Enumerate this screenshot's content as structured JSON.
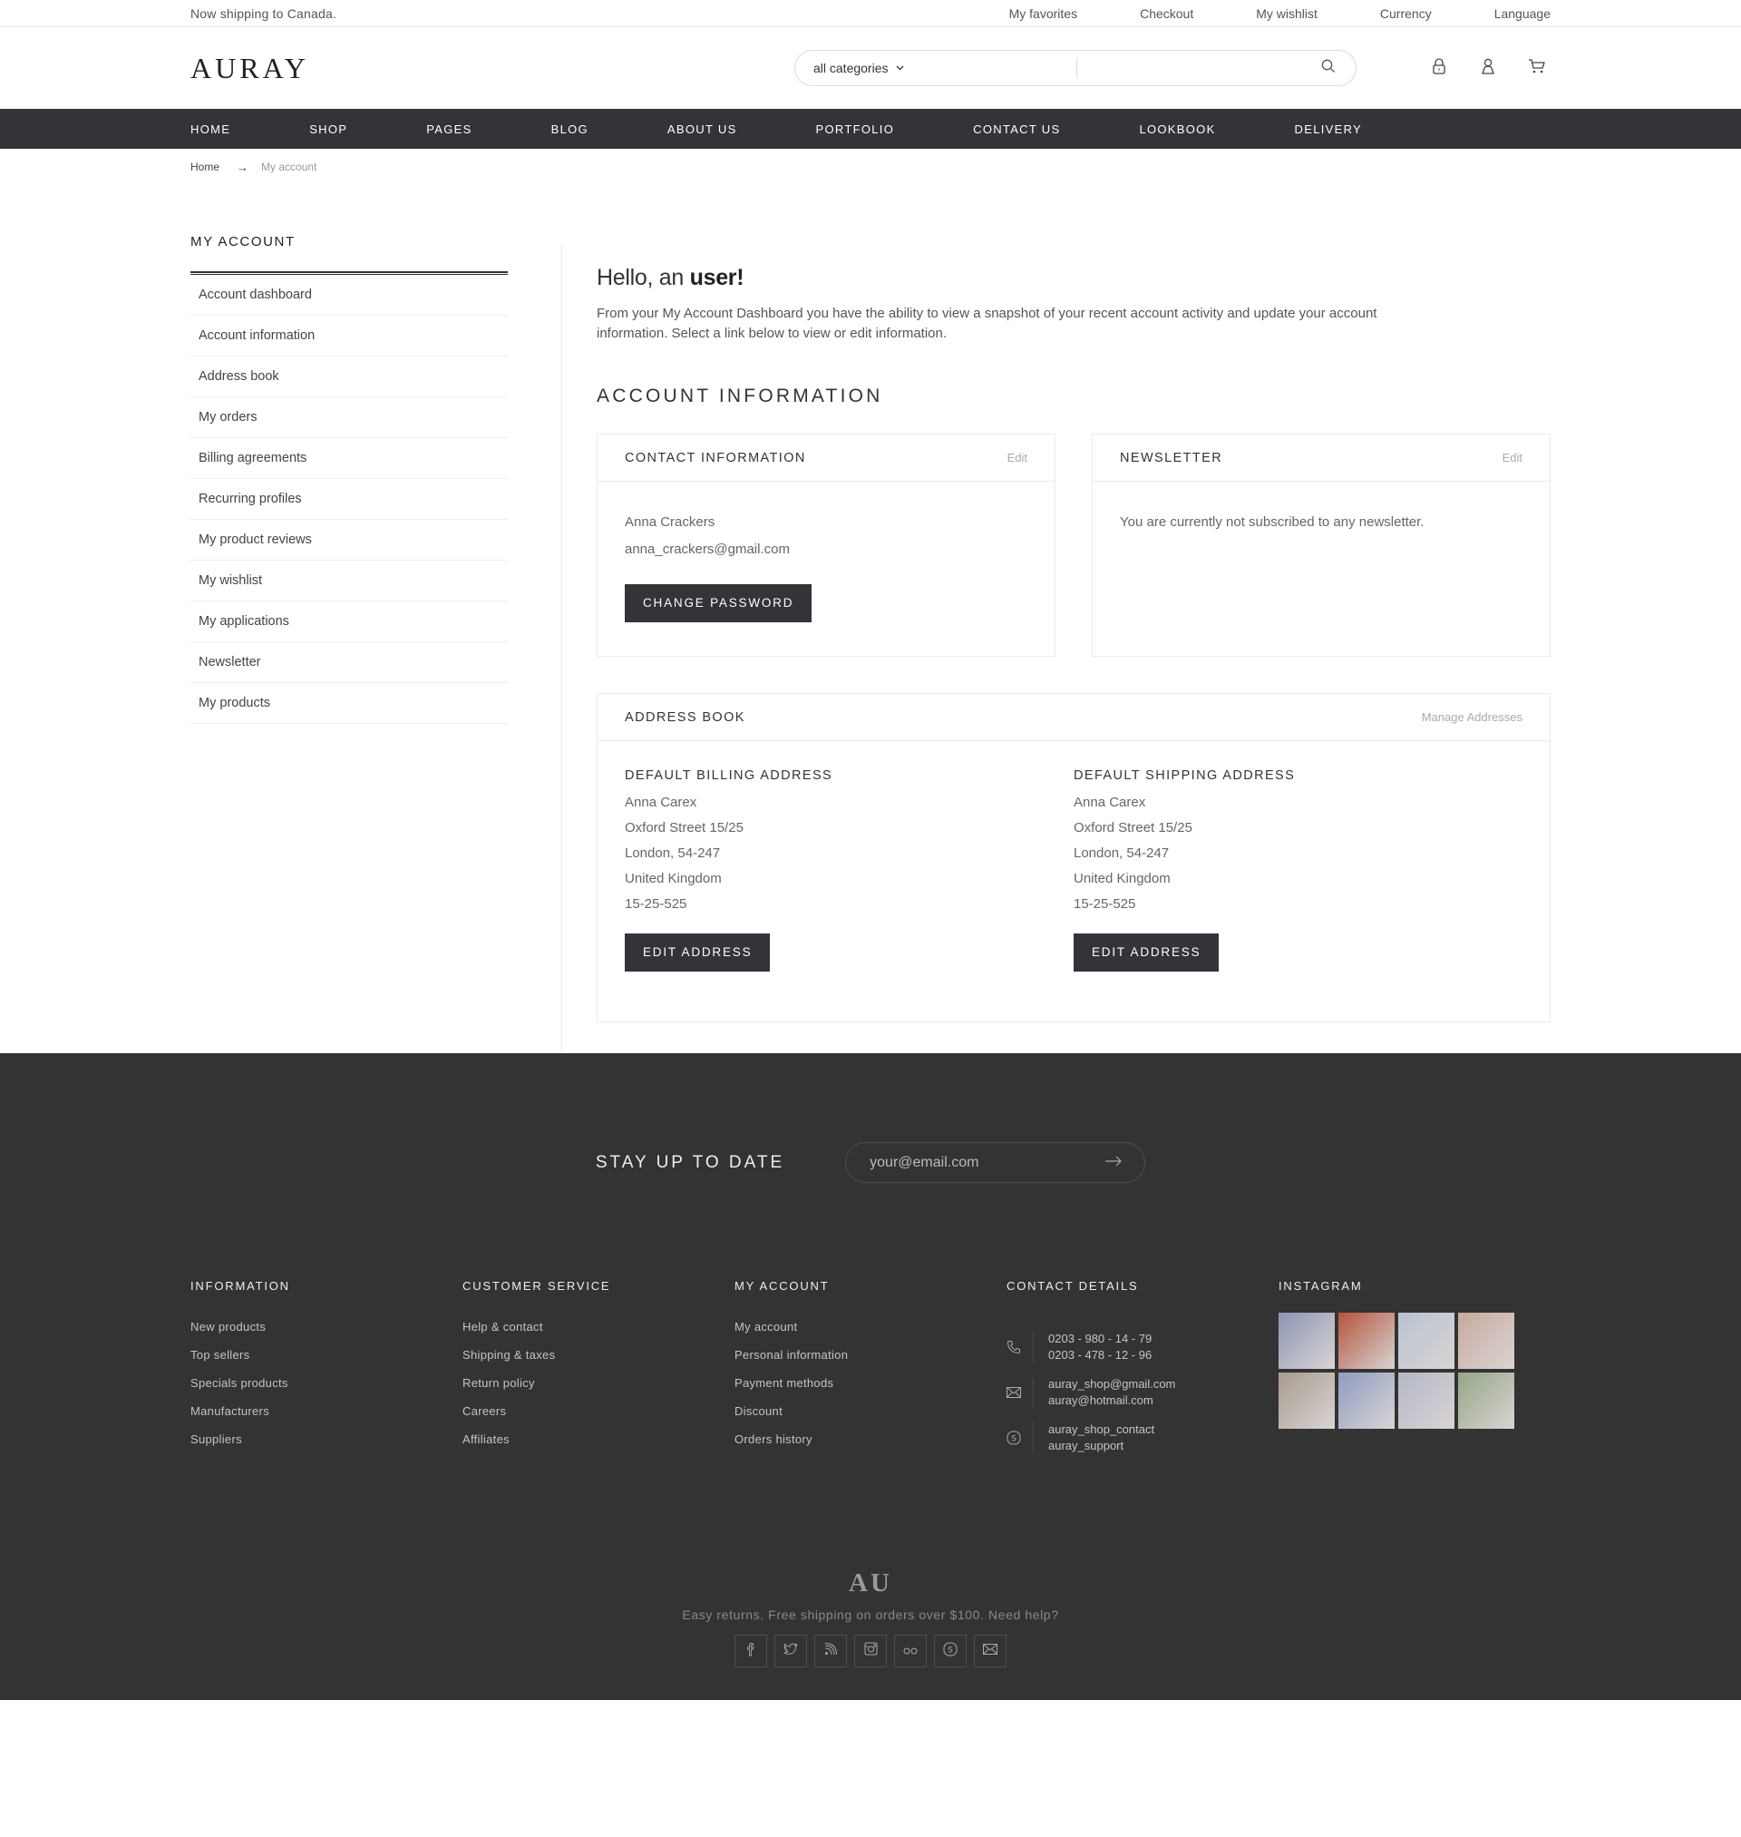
{
  "topbar": {
    "shipping_note": "Now shipping to Canada.",
    "links": [
      "My favorites",
      "Checkout",
      "My wishlist",
      "Currency",
      "Language"
    ]
  },
  "header": {
    "logo": "AURAY",
    "search": {
      "category": "all categories",
      "placeholder": "",
      "value": ""
    },
    "icons": [
      "lock-icon",
      "user-icon",
      "cart-icon"
    ]
  },
  "nav": {
    "items": [
      "HOME",
      "SHOP",
      "PAGES",
      "BLOG",
      "ABOUT US",
      "PORTFOLIO",
      "CONTACT US",
      "LOOKBOOK",
      "DELIVERY"
    ]
  },
  "breadcrumb": {
    "home": "Home",
    "separator": "→",
    "current": "My account"
  },
  "sidebar": {
    "title": "MY ACCOUNT",
    "items": [
      "Account dashboard",
      "Account information",
      "Address book",
      "My orders",
      "Billing agreements",
      "Recurring profiles",
      "My product reviews",
      "My wishlist",
      "My applications",
      "Newsletter",
      "My products"
    ]
  },
  "main": {
    "greeting_prefix": "Hello, an ",
    "greeting_name": "user!",
    "intro": "From your My Account Dashboard you have the ability to view a snapshot of your recent account activity and update your account information. Select a link below to view or edit information.",
    "section_title": "ACCOUNT INFORMATION",
    "contact": {
      "title": "CONTACT INFORMATION",
      "edit": "Edit",
      "name": "Anna Crackers",
      "email": "anna_crackers@gmail.com",
      "button": "CHANGE PASSWORD"
    },
    "newsletter": {
      "title": "NEWSLETTER",
      "edit": "Edit",
      "message": "You are currently not subscribed to any newsletter."
    },
    "address_book": {
      "title": "ADDRESS BOOK",
      "manage": "Manage Addresses",
      "billing": {
        "title": "DEFAULT BILLING ADDRESS",
        "name": "Anna Carex",
        "street": "Oxford Street 15/25",
        "city": "London, 54-247",
        "country": "United Kingdom",
        "phone": "15-25-525",
        "button": "EDIT ADDRESS"
      },
      "shipping": {
        "title": "DEFAULT SHIPPING ADDRESS",
        "name": "Anna Carex",
        "street": "Oxford Street 15/25",
        "city": "London, 54-247",
        "country": "United Kingdom",
        "phone": "15-25-525",
        "button": "EDIT ADDRESS"
      }
    }
  },
  "footer": {
    "subscribe_label": "STAY UP TO DATE",
    "subscribe_placeholder": "your@email.com",
    "columns": {
      "information": {
        "title": "INFORMATION",
        "links": [
          "New products",
          "Top sellers",
          "Specials products",
          "Manufacturers",
          "Suppliers"
        ]
      },
      "customer_service": {
        "title": "CUSTOMER SERVICE",
        "links": [
          "Help & contact",
          "Shipping & taxes",
          "Return policy",
          "Careers",
          "Affiliates"
        ]
      },
      "my_account": {
        "title": "MY ACCOUNT",
        "links": [
          "My account",
          "Personal information",
          "Payment methods",
          "Discount",
          "Orders history"
        ]
      },
      "contact": {
        "title": "CONTACT DETAILS",
        "phone1": "0203 - 980 - 14 - 79",
        "phone2": "0203 - 478 - 12 - 96",
        "email1": "auray_shop@gmail.com",
        "email2": "auray@hotmail.com",
        "skype1": "auray_shop_contact",
        "skype2": "auray_support"
      },
      "instagram": {
        "title": "INSTAGRAM",
        "tile_colors": [
          "#8d95b3",
          "#b5543d",
          "#b9c3d1",
          "#c8a99c",
          "#a79b8e",
          "#8f9cc0",
          "#b4b7c7",
          "#95a685"
        ]
      }
    },
    "logo": "AU",
    "note": "Easy returns. Free shipping on orders over $100. Need help?",
    "socials": [
      "facebook-icon",
      "twitter-icon",
      "rss-icon",
      "instagram-icon",
      "flickr-icon",
      "skype-icon",
      "mail-icon"
    ]
  },
  "colors": {
    "nav_bg": "#323437",
    "button_bg": "#323437",
    "footer_bg": "#333333"
  }
}
